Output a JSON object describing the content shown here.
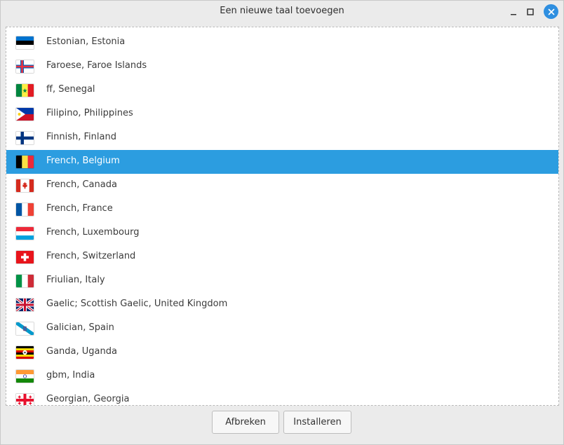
{
  "window": {
    "title": "Een nieuwe taal toevoegen"
  },
  "languages": [
    {
      "label": "Estonian, Estonia",
      "flag": "flag-estonia-icon",
      "selected": false
    },
    {
      "label": "Faroese, Faroe Islands",
      "flag": "flag-faroe-islands-icon",
      "selected": false
    },
    {
      "label": "ff, Senegal",
      "flag": "flag-senegal-icon",
      "selected": false
    },
    {
      "label": "Filipino, Philippines",
      "flag": "flag-philippines-icon",
      "selected": false
    },
    {
      "label": "Finnish, Finland",
      "flag": "flag-finland-icon",
      "selected": false
    },
    {
      "label": "French, Belgium",
      "flag": "flag-belgium-icon",
      "selected": true
    },
    {
      "label": "French, Canada",
      "flag": "flag-canada-icon",
      "selected": false
    },
    {
      "label": "French, France",
      "flag": "flag-france-icon",
      "selected": false
    },
    {
      "label": "French, Luxembourg",
      "flag": "flag-luxembourg-icon",
      "selected": false
    },
    {
      "label": "French, Switzerland",
      "flag": "flag-switzerland-icon",
      "selected": false
    },
    {
      "label": "Friulian, Italy",
      "flag": "flag-italy-icon",
      "selected": false
    },
    {
      "label": "Gaelic; Scottish Gaelic, United Kingdom",
      "flag": "flag-united-kingdom-icon",
      "selected": false
    },
    {
      "label": "Galician, Spain",
      "flag": "flag-galicia-icon",
      "selected": false
    },
    {
      "label": "Ganda, Uganda",
      "flag": "flag-uganda-icon",
      "selected": false
    },
    {
      "label": "gbm, India",
      "flag": "flag-india-icon",
      "selected": false
    },
    {
      "label": "Georgian, Georgia",
      "flag": "flag-georgia-icon",
      "selected": false
    }
  ],
  "buttons": {
    "cancel_label": "Afbreken",
    "install_label": "Installeren"
  },
  "colors": {
    "selection": "#2c9de0",
    "close_button": "#2f8fe0"
  }
}
